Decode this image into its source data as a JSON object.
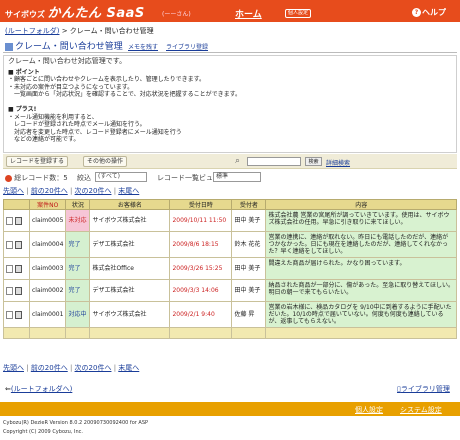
{
  "header": {
    "logo_small": "サイボウズ",
    "logo_big": "かんたん SaaS",
    "user_name": "(ーーさん)",
    "home": "ホーム",
    "settings": "個人設定",
    "help": "ヘルプ"
  },
  "breadcrumb": {
    "root": "(ルートフォルダ)",
    "current": "クレーム・問い合わせ管理"
  },
  "app": {
    "title": "クレーム・問い合わせ管理",
    "memo_link": "メモを残す",
    "library_link": "ライブラリ登録"
  },
  "description": {
    "lead": "クレーム・問い合わせ対応管理です。",
    "lines": [
      "■ ポイント",
      "・顧客ごとに問い合わせやクレームを表示したり、管理したりできます。",
      "・未対応の案件が目立つようになっています。",
      "　一覧画面から「対応状況」を確認することで、対応状況を把握することができます。",
      "",
      "■ プラス!",
      "・メール通知機能を利用すると、",
      "　レコードが登録された時点でメール通知を行う。",
      "　対応者を変更した時点で、レコード登録者にメール通知を行う",
      "　などの連絡が可能です。"
    ]
  },
  "toolbar": {
    "new_record": "レコードを登録する",
    "other_ops": "その他の操作",
    "search_btn": "検索",
    "adv_search": "詳細検索"
  },
  "filter": {
    "records_label": "総レコード数：5",
    "narrow_label": "絞込",
    "narrow_value": "(すべて)",
    "view_label": "レコード一覧ビュー",
    "view_value": "標準"
  },
  "pager": {
    "first": "先頭へ",
    "prev": "前の20件へ",
    "next": "次の20件へ",
    "last": "末尾へ"
  },
  "table": {
    "headers": [
      "",
      "案件NO",
      "状況",
      "お客様名",
      "受付日時",
      "受付者",
      "内容"
    ],
    "rows": [
      {
        "no": "claim0005",
        "status": "未対応",
        "status_class": "st-pink",
        "customer": "サイボウズ株式会社",
        "date": "2009/10/11 11:50",
        "staff": "田中 美子",
        "content": "株式会社農 営業の宮尾所が調っていきています。使用は、サイボウズ株式会社の任用。早急に引き取りに来てほしい。"
      },
      {
        "no": "claim0004",
        "status": "完了",
        "status_class": "st-green",
        "customer": "デザエ株式会社",
        "date": "2009/8/6 18:15",
        "staff": "鈴木 花花",
        "content": "営業の連携に、連絡が取れない。昨日にも電話したのだが、連絡がつかなかった。日にも現在を連絡したのだが、連絡してくれなかった？早く連絡をしてほしい。"
      },
      {
        "no": "claim0003",
        "status": "完了",
        "status_class": "st-green",
        "customer": "株式会社Office",
        "date": "2009/3/26 15:25",
        "staff": "田中 美子",
        "content": "間違えた商品が届けられた。かなり困っています。"
      },
      {
        "no": "claim0002",
        "status": "完了",
        "status_class": "st-green",
        "customer": "デザエ株式会社",
        "date": "2009/3/3 14:06",
        "staff": "田中 美子",
        "content": "納品された商品が一部分に、傷があった。至急に取り替えてほしい。明日の朝一で来てもらいたい。"
      },
      {
        "no": "claim0001",
        "status": "対応中",
        "status_class": "st-teal",
        "customer": "サイボウズ株式会社",
        "date": "2009/2/1 9:40",
        "staff": "佐藤 昇",
        "content": "営業の岩木様に、検品カタログを 9/10中に到着するように手配いただいた。10/1の時点で届いていない。何度も何度も連絡しているが、返事してもらえない。"
      }
    ]
  },
  "footer": {
    "back": "(ルートフォルダへ)",
    "library": "ライブラリ管理",
    "link1": "個人設定",
    "link2": "システム設定",
    "version": "Cybozu(R) DezieR Version 8.0.2 20090730092400 for ASP",
    "copyright": "Copyright (C) 2009 Cybozu, Inc."
  },
  "colors": {
    "header": "#e74c1c",
    "table_header": "#e6d98e",
    "footer": "#e8a000"
  }
}
